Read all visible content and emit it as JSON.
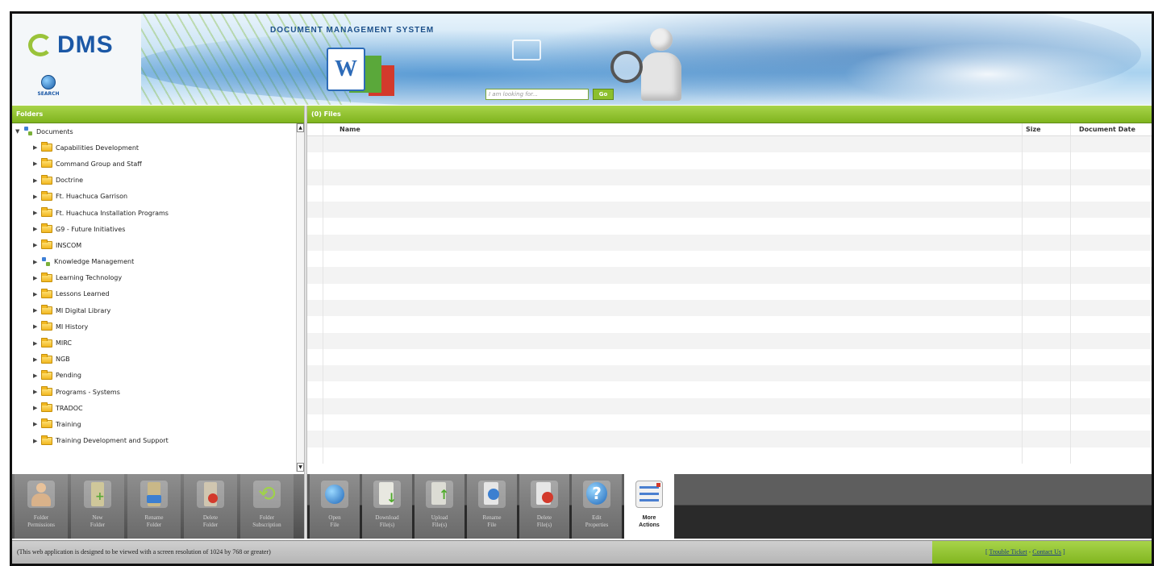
{
  "header": {
    "logo_text": "DMS",
    "search_label": "SEARCH",
    "app_title": "DOCUMENT MANAGEMENT SYSTEM",
    "search_placeholder": "I am looking for...",
    "go_label": "Go"
  },
  "folders_panel": {
    "title": "Folders",
    "root": "Documents",
    "items": [
      {
        "label": "Capabilities Development",
        "icon": "folder-icon"
      },
      {
        "label": "Command Group and Staff",
        "icon": "folder-icon"
      },
      {
        "label": "Doctrine",
        "icon": "folder-icon"
      },
      {
        "label": "Ft. Huachuca Garrison",
        "icon": "folder-icon"
      },
      {
        "label": "Ft. Huachuca Installation Programs",
        "icon": "folder-icon"
      },
      {
        "label": "G9 - Future Initiatives",
        "icon": "folder-icon"
      },
      {
        "label": "INSCOM",
        "icon": "folder-icon"
      },
      {
        "label": "Knowledge Management",
        "icon": "network-icon"
      },
      {
        "label": "Learning Technology",
        "icon": "folder-icon"
      },
      {
        "label": "Lessons Learned",
        "icon": "folder-icon"
      },
      {
        "label": "MI Digital Library",
        "icon": "folder-icon"
      },
      {
        "label": "MI History",
        "icon": "folder-icon"
      },
      {
        "label": "MIRC",
        "icon": "folder-icon"
      },
      {
        "label": "NGB",
        "icon": "folder-icon"
      },
      {
        "label": "Pending",
        "icon": "folder-icon"
      },
      {
        "label": "Programs - Systems",
        "icon": "folder-icon"
      },
      {
        "label": "TRADOC",
        "icon": "folder-icon"
      },
      {
        "label": "Training",
        "icon": "folder-icon"
      },
      {
        "label": "Training Development and Support",
        "icon": "folder-icon"
      }
    ]
  },
  "files_panel": {
    "title": "(0) Files",
    "columns": {
      "name": "Name",
      "size": "Size",
      "date": "Document Date"
    }
  },
  "folder_toolbar": {
    "buttons": [
      {
        "label": "Folder\nPermissions",
        "icon": "user-permissions-icon"
      },
      {
        "label": "New\nFolder",
        "icon": "new-folder-icon"
      },
      {
        "label": "Rename\nFolder",
        "icon": "rename-folder-icon"
      },
      {
        "label": "Delete\nFolder",
        "icon": "delete-folder-icon"
      },
      {
        "label": "Folder\nSubscription",
        "icon": "subscription-icon"
      }
    ]
  },
  "file_toolbar": {
    "buttons": [
      {
        "label": "Open\nFile",
        "icon": "open-file-icon"
      },
      {
        "label": "Download\nFile(s)",
        "icon": "download-icon"
      },
      {
        "label": "Upload\nFile(s)",
        "icon": "upload-icon"
      },
      {
        "label": "Rename\nFile",
        "icon": "rename-file-icon"
      },
      {
        "label": "Delete\nFile(s)",
        "icon": "delete-file-icon"
      },
      {
        "label": "Edit\nProperties",
        "icon": "help-icon"
      },
      {
        "label": "More\nActions",
        "icon": "more-actions-icon"
      }
    ]
  },
  "footer": {
    "note": "(This web application is designed to be viewed with a screen resolution of 1024 by 768 or greater)",
    "link_open": "[ ",
    "trouble_ticket": "Trouble Ticket",
    "separator": " - ",
    "contact_us": "Contact Us",
    "link_close": " ]"
  },
  "colors": {
    "accent_green": "#8cbf2c",
    "brand_blue": "#1b58a6",
    "toolbar_gray": "#6a6a6a"
  }
}
